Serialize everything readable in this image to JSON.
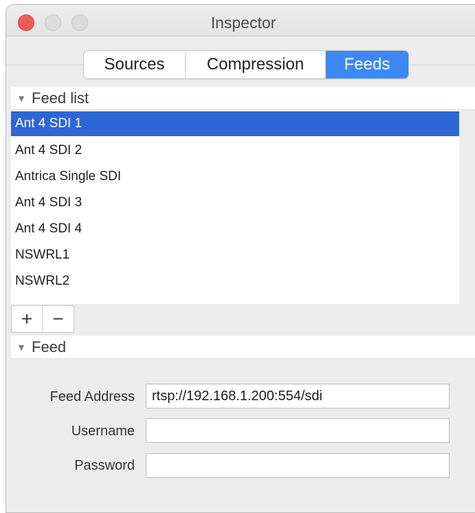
{
  "window": {
    "title": "Inspector"
  },
  "tabs": [
    {
      "label": "Sources",
      "active": false
    },
    {
      "label": "Compression",
      "active": false
    },
    {
      "label": "Feeds",
      "active": true
    }
  ],
  "feed_list": {
    "header": "Feed list",
    "items": [
      {
        "label": "Ant 4 SDI 1",
        "selected": true
      },
      {
        "label": "Ant 4 SDI 2",
        "selected": false
      },
      {
        "label": "Antrica Single SDI",
        "selected": false
      },
      {
        "label": "Ant 4 SDI 3",
        "selected": false
      },
      {
        "label": "Ant 4 SDI 4",
        "selected": false
      },
      {
        "label": "NSWRL1",
        "selected": false
      },
      {
        "label": "NSWRL2",
        "selected": false
      }
    ],
    "add_symbol": "+",
    "remove_symbol": "−"
  },
  "feed": {
    "header": "Feed",
    "address_label": "Feed Address",
    "address_value": "rtsp://192.168.1.200:554/sdi",
    "username_label": "Username",
    "username_value": "",
    "password_label": "Password",
    "password_value": ""
  },
  "colors": {
    "accent": "#3b88f5",
    "selection": "#2f66d5",
    "close": "#ee5b56"
  }
}
